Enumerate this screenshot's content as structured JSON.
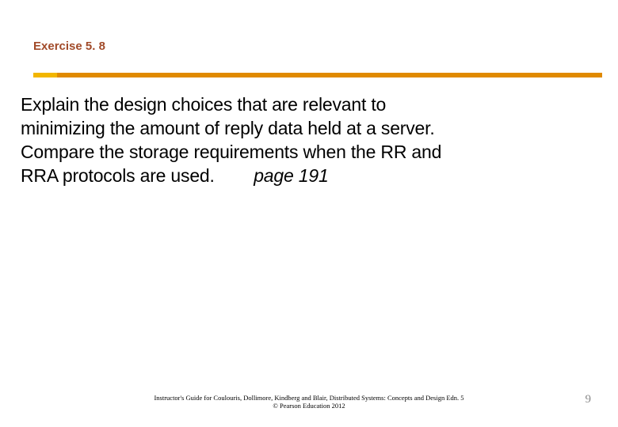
{
  "title": "Exercise 5. 8",
  "body_line1": "Explain the design choices that are relevant to",
  "body_line2": "minimizing the amount of reply data held at a server.",
  "body_line3": "Compare the storage requirements when the RR and",
  "body_line4_pre": "RRA protocols are used.        ",
  "body_pageref": "page 191",
  "footer_line1": "Instructor's Guide for  Coulouris, Dollimore, Kindberg and Blair,  Distributed Systems: Concepts and Design   Edn. 5",
  "footer_line2": "©  Pearson Education 2012",
  "page_number": "9",
  "colors": {
    "title": "#a14a29",
    "rule_left": "#f2b600",
    "rule_right": "#e08a00"
  }
}
